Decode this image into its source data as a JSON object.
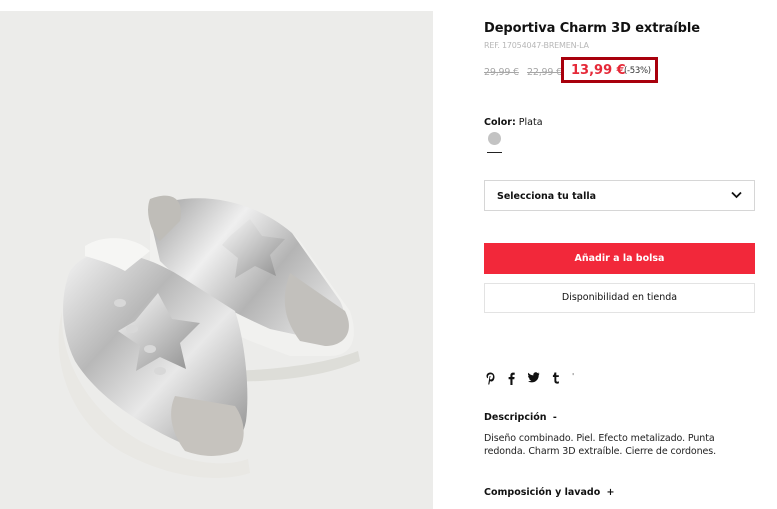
{
  "product": {
    "title": "Deportiva Charm 3D extraíble",
    "ref": "REF. 17054047-BREMEN-LA",
    "prices": {
      "original_1": "29,99 €",
      "original_2": "22,99 €",
      "current": "13,99 €",
      "discount": "(-53%)"
    },
    "color": {
      "label": "Color:",
      "value": "Plata",
      "swatch_hex": "#c3c3c3"
    },
    "size_select": {
      "placeholder": "Selecciona tu talla"
    },
    "add_to_bag": "Añadir a la bolsa",
    "store_availability": "Disponibilidad en tienda",
    "share_icons": [
      "pinterest-icon",
      "facebook-icon",
      "twitter-icon",
      "tumblr-icon"
    ],
    "description": {
      "heading": "Descripción",
      "toggle": "-",
      "text": "Diseño combinado. Piel. Efecto metalizado. Punta redonda. Charm 3D extraíble. Cierre de cordones."
    },
    "composition": {
      "heading": "Composición y lavado",
      "toggle": "+"
    }
  },
  "colors": {
    "accent_red": "#f2283a",
    "price_red": "#e52938",
    "highlight_border": "#a8000c"
  }
}
